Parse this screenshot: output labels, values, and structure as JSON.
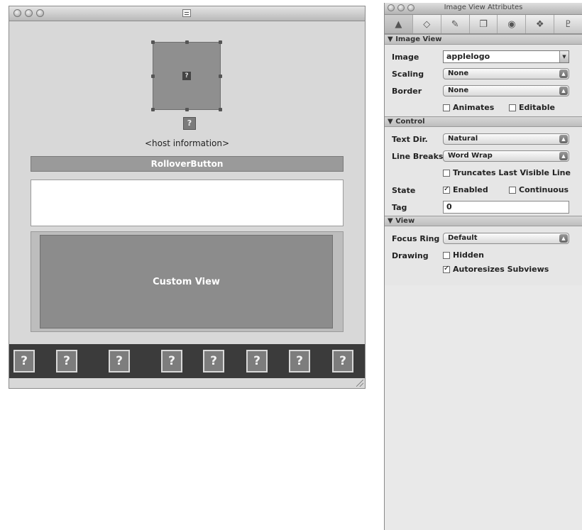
{
  "design_window": {
    "image_placeholder_glyph": "?",
    "host_label": "<host information>",
    "rollover_label": "RolloverButton",
    "custom_view_label": "Custom View",
    "toolbar_buttons": [
      "?",
      "?",
      "?",
      "?",
      "?",
      "?",
      "?",
      "?"
    ]
  },
  "inspector": {
    "title": "Image View Attributes",
    "tab_icons": [
      "attributes-icon",
      "effects-icon",
      "size-icon",
      "connections-icon",
      "bindings-icon",
      "info-icon",
      "identity-icon"
    ],
    "image_view": {
      "header": "Image View",
      "image_label": "Image",
      "image_value": "applelogo",
      "scaling_label": "Scaling",
      "scaling_value": "None",
      "border_label": "Border",
      "border_value": "None",
      "animates_label": "Animates",
      "animates_checked": false,
      "editable_label": "Editable",
      "editable_checked": false
    },
    "control": {
      "header": "Control",
      "text_dir_label": "Text Dir.",
      "text_dir_value": "Natural",
      "line_breaks_label": "Line Breaks",
      "line_breaks_value": "Word Wrap",
      "truncates_label": "Truncates Last Visible Line",
      "truncates_checked": false,
      "state_label": "State",
      "enabled_label": "Enabled",
      "enabled_checked": true,
      "continuous_label": "Continuous",
      "continuous_checked": false,
      "tag_label": "Tag",
      "tag_value": "0"
    },
    "view": {
      "header": "View",
      "focus_ring_label": "Focus Ring",
      "focus_ring_value": "Default",
      "drawing_label": "Drawing",
      "hidden_label": "Hidden",
      "hidden_checked": false,
      "autoresizes_label": "Autoresizes Subviews",
      "autoresizes_checked": true
    }
  }
}
